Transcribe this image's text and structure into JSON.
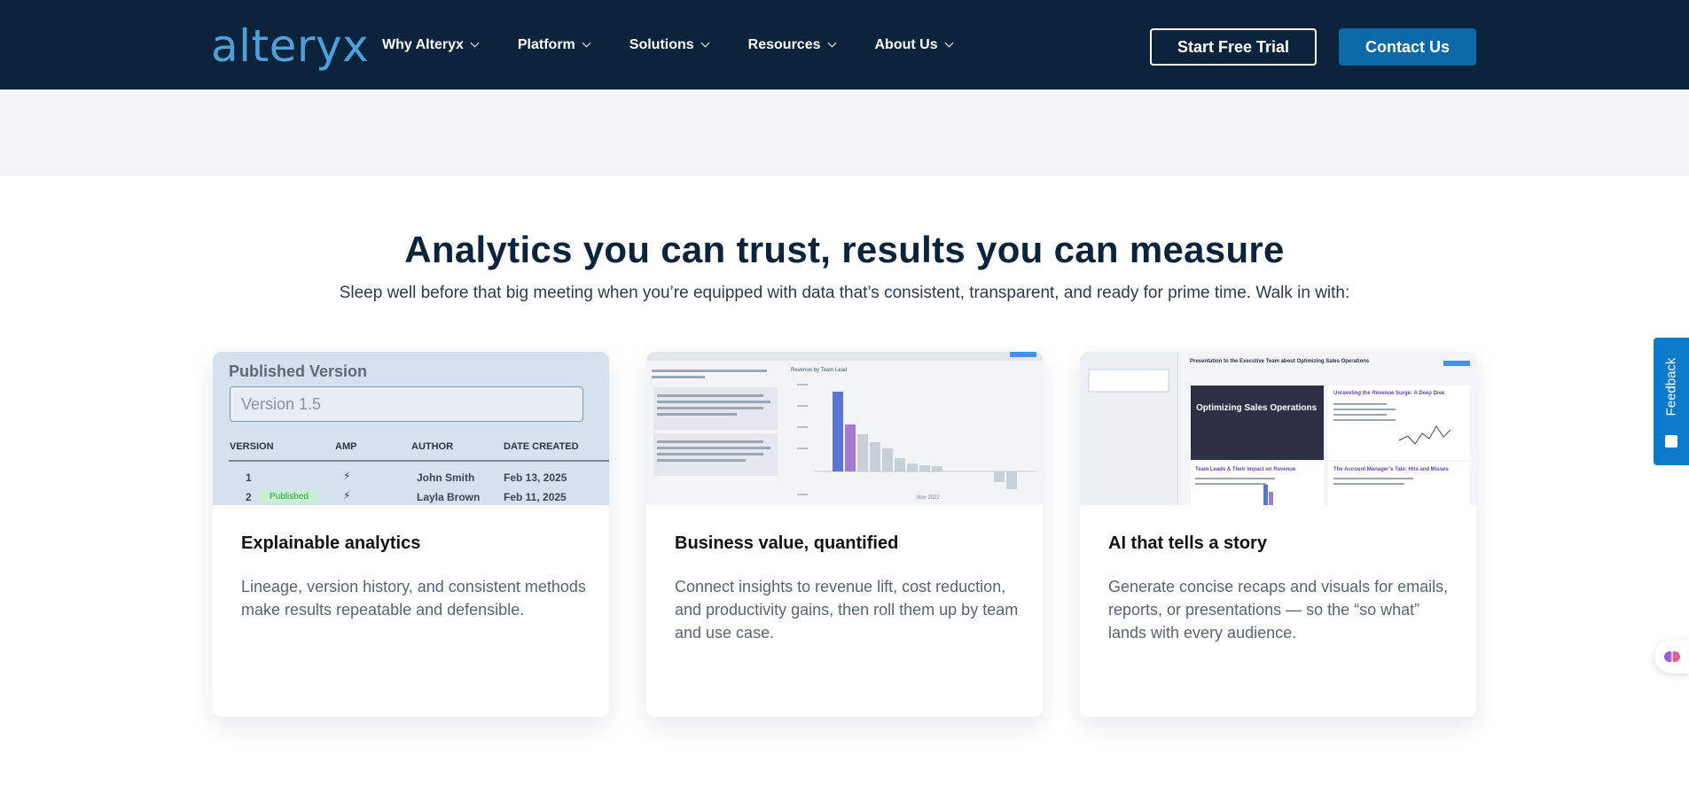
{
  "nav": {
    "logo": "alteryx",
    "menu": [
      {
        "label": "Why Alteryx"
      },
      {
        "label": "Platform"
      },
      {
        "label": "Solutions"
      },
      {
        "label": "Resources"
      },
      {
        "label": "About Us"
      }
    ],
    "trial_label": "Start Free Trial",
    "contact_label": "Contact Us"
  },
  "hero": {
    "title": "Analytics you can trust, results you can measure",
    "subtitle": "Sleep well before that big meeting when you’re equipped with data that’s consistent, transparent, and ready for prime time. Walk in with:"
  },
  "cards": [
    {
      "title": "Explainable analytics",
      "text": "Lineage, version history, and consistent methods make results repeatable and defensible.",
      "image": {
        "panel_title": "Published Version",
        "input_value": "Version 1.5",
        "headers": [
          "VERSION",
          "AMP",
          "AUTHOR",
          "DATE CREATED"
        ],
        "rows": [
          {
            "version": "1",
            "badge": "",
            "amp": "⚡",
            "author": "John Smith",
            "date": "Feb 13, 2025"
          },
          {
            "version": "2",
            "badge": "Published",
            "amp": "⚡",
            "author": "Layla Brown",
            "date": "Feb 11, 2025"
          }
        ]
      }
    },
    {
      "title": "Business value, quantified",
      "text": "Connect insights to revenue lift, cost reduction, and productivity gains, then roll them up by team and use case.",
      "image": {
        "chart_title": "Revenue by Team Lead",
        "x_label": "Nov 2022"
      }
    },
    {
      "title": "AI that tells a story",
      "text": "Generate concise recaps and visuals for emails, reports, or presentations — so the “so what” lands with every audience.",
      "image": {
        "doc_title": "Presentation to the Executive Team about Optimizing Sales Operations",
        "hero_text": "Optimizing Sales Operations",
        "section_a": "Unraveling the Revenue Surge: A Deep Dive",
        "section_b": "Team Leads & Their Impact on Revenue",
        "section_c": "The Account Manager’s Tale: Hits and Misses"
      }
    }
  ],
  "widgets": {
    "feedback_label": "Feedback"
  },
  "colors": {
    "nav_bg": "#0b233b",
    "logo": "#4fa0d8",
    "contact_bg": "#0d68a6",
    "feedback_bg": "#0d7bc9"
  }
}
